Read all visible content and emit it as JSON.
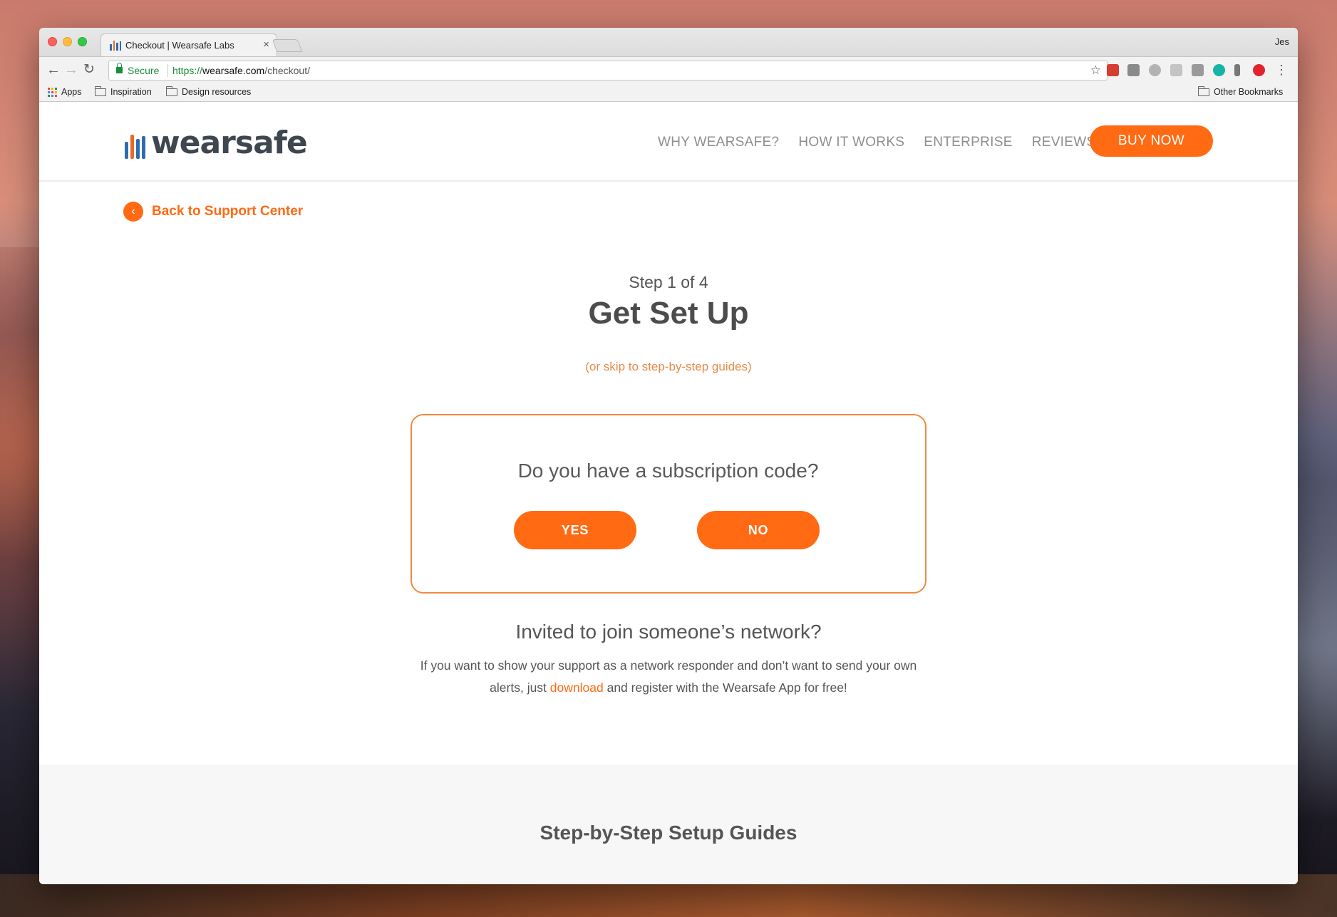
{
  "browser": {
    "tab_title": "Checkout | Wearsafe Labs",
    "tab_close": "×",
    "profile_name": "Jes",
    "secure_label": "Secure",
    "url_scheme": "https://",
    "url_host": "wearsafe.com",
    "url_path": "/checkout/",
    "bookmarks": {
      "apps": "Apps",
      "inspiration": "Inspiration",
      "design_resources": "Design resources",
      "other": "Other Bookmarks"
    },
    "extensions": [
      "todoist-icon",
      "extension-icon",
      "drive-icon",
      "extension-icon",
      "extension-icon",
      "m-icon",
      "r-icon",
      "pinterest-icon"
    ]
  },
  "site": {
    "logo_text": "wearsafe",
    "nav": [
      "WHY WEARSAFE?",
      "HOW IT WORKS",
      "ENTERPRISE",
      "REVIEWS"
    ],
    "buy_now": "BUY NOW",
    "accent": "#ff6a13"
  },
  "main": {
    "back_link": "Back to Support Center",
    "step": "Step 1 of 4",
    "title": "Get Set Up",
    "skip": "(or skip to step-by-step guides)",
    "question": "Do you have a subscription code?",
    "yes": "YES",
    "no": "NO",
    "invited_title": "Invited to join someone’s network?",
    "invited_desc_before": "If you want to show your support as a network responder and don’t want to send your own alerts, just ",
    "invited_link": "download",
    "invited_desc_after": " and register with the Wearsafe App for free!"
  },
  "guides": {
    "title": "Step-by-Step Setup Guides"
  }
}
